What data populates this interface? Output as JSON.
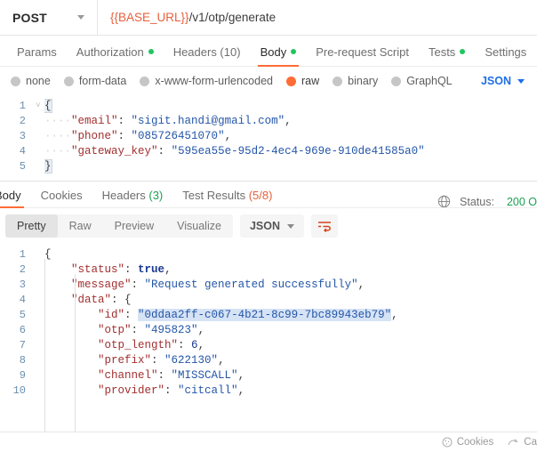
{
  "urlbar": {
    "method": "POST",
    "url_variable": "{{BASE_URL}}",
    "url_path": "/v1/otp/generate"
  },
  "request_tabs": [
    {
      "label": "Params",
      "dot": false,
      "active": false
    },
    {
      "label": "Authorization",
      "dot": true,
      "active": false
    },
    {
      "label": "Headers (10)",
      "dot": false,
      "active": false
    },
    {
      "label": "Body",
      "dot": true,
      "active": true
    },
    {
      "label": "Pre-request Script",
      "dot": false,
      "active": false
    },
    {
      "label": "Tests",
      "dot": true,
      "active": false
    },
    {
      "label": "Settings",
      "dot": false,
      "active": false
    }
  ],
  "body_types": [
    {
      "label": "none",
      "selected": false
    },
    {
      "label": "form-data",
      "selected": false
    },
    {
      "label": "x-www-form-urlencoded",
      "selected": false
    },
    {
      "label": "raw",
      "selected": true
    },
    {
      "label": "binary",
      "selected": false
    },
    {
      "label": "GraphQL",
      "selected": false
    }
  ],
  "body_format": "JSON",
  "request_body": {
    "lines": [
      {
        "num": "1",
        "fold": "˅",
        "text": "{"
      },
      {
        "num": "2",
        "fold": "",
        "text": "    \"email\": \"sigit.handi@gmail.com\","
      },
      {
        "num": "3",
        "fold": "",
        "text": "    \"phone\": \"085726451070\","
      },
      {
        "num": "4",
        "fold": "",
        "text": "    \"gateway_key\": \"595ea55e-95d2-4ec4-969e-910de41585a0\""
      },
      {
        "num": "5",
        "fold": "",
        "text": "}"
      }
    ],
    "keys": [
      "email",
      "phone",
      "gateway_key"
    ],
    "values": {
      "email": "sigit.handi@gmail.com",
      "phone": "085726451070",
      "gateway_key": "595ea55e-95d2-4ec4-969e-910de41585a0"
    }
  },
  "response_tabs": [
    {
      "label": "Body",
      "active": true
    },
    {
      "label": "Cookies",
      "active": false
    },
    {
      "label": "Headers",
      "count": "(3)",
      "count_color": "green",
      "active": false
    },
    {
      "label": "Test Results",
      "count": "(5/8)",
      "count_color": "orange",
      "active": false
    }
  ],
  "response_status": {
    "prefix": "Status:",
    "code": "200 O"
  },
  "response_views": [
    {
      "label": "Pretty",
      "active": true
    },
    {
      "label": "Raw",
      "active": false
    },
    {
      "label": "Preview",
      "active": false
    },
    {
      "label": "Visualize",
      "active": false
    }
  ],
  "response_format": "JSON",
  "response_body": {
    "lines": [
      {
        "num": "1",
        "text": "{"
      },
      {
        "num": "2",
        "text": "    \"status\": true,"
      },
      {
        "num": "3",
        "text": "    \"message\": \"Request generated successfully\","
      },
      {
        "num": "4",
        "text": "    \"data\": {"
      },
      {
        "num": "5",
        "text": "        \"id\": \"0ddaa2ff-c067-4b21-8c99-7bc89943eb79\","
      },
      {
        "num": "6",
        "text": "        \"otp\": \"495823\","
      },
      {
        "num": "7",
        "text": "        \"otp_length\": 6,"
      },
      {
        "num": "8",
        "text": "        \"prefix\": \"622130\","
      },
      {
        "num": "9",
        "text": "        \"channel\": \"MISSCALL\","
      },
      {
        "num": "10",
        "text": "        \"provider\": \"citcall\","
      }
    ],
    "values": {
      "status": true,
      "message": "Request generated successfully",
      "id": "0ddaa2ff-c067-4b21-8c99-7bc89943eb79",
      "otp": "495823",
      "otp_length": 6,
      "prefix": "622130",
      "channel": "MISSCALL",
      "provider": "citcall"
    }
  },
  "bottom_bar": [
    {
      "label": "Cookies",
      "icon": "cookie-icon"
    },
    {
      "label": "Ca",
      "icon": "capture-icon"
    }
  ],
  "colors": {
    "accent": "#ff6c37",
    "status_green": "#1aa053",
    "dot_green": "#20c55f",
    "variable_red": "#e8603c",
    "json_blue": "#1f6fe5"
  }
}
